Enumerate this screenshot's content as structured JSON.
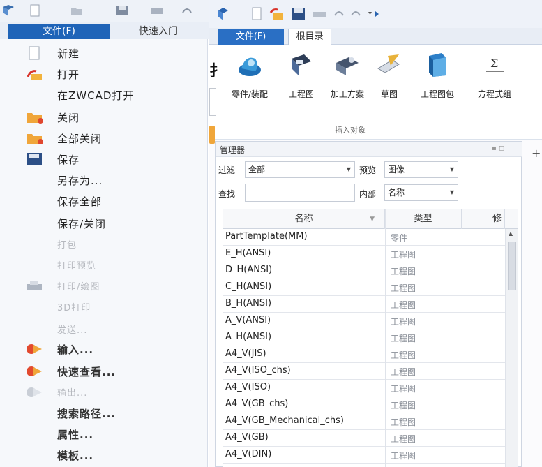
{
  "left_app": {
    "tabs": {
      "file": "文件(F)",
      "quick_start": "快速入门"
    },
    "menu": [
      {
        "label": "新建",
        "icon": "new-file-icon",
        "state": "normal"
      },
      {
        "label": "打开",
        "icon": "open-folder-icon",
        "state": "normal"
      },
      {
        "label": "在ZWCAD打开",
        "icon": "",
        "state": "normal"
      },
      {
        "label": "关闭",
        "icon": "close-folder-icon",
        "state": "normal"
      },
      {
        "label": "全部关闭",
        "icon": "close-all-icon",
        "state": "normal"
      },
      {
        "label": "保存",
        "icon": "save-icon",
        "state": "normal"
      },
      {
        "label": "另存为...",
        "icon": "",
        "state": "normal"
      },
      {
        "label": "保存全部",
        "icon": "",
        "state": "normal"
      },
      {
        "label": "保存/关闭",
        "icon": "",
        "state": "normal"
      },
      {
        "label": "打包",
        "icon": "",
        "state": "disabled"
      },
      {
        "label": "打印预览",
        "icon": "",
        "state": "disabled"
      },
      {
        "label": "打印/绘图",
        "icon": "printer-icon",
        "state": "disabled"
      },
      {
        "label": "3D打印",
        "icon": "",
        "state": "disabled"
      },
      {
        "label": "发送...",
        "icon": "",
        "state": "disabled"
      },
      {
        "label": "输入...",
        "icon": "import-icon",
        "state": "bold"
      },
      {
        "label": "快速查看...",
        "icon": "quick-view-icon",
        "state": "bold"
      },
      {
        "label": "输出...",
        "icon": "export-icon",
        "state": "disabled"
      },
      {
        "label": "搜索路径...",
        "icon": "",
        "state": "bold"
      },
      {
        "label": "属性...",
        "icon": "",
        "state": "bold"
      },
      {
        "label": "模板...",
        "icon": "",
        "state": "bold"
      }
    ]
  },
  "right_app": {
    "tabs": {
      "file": "文件(F)",
      "root": "根目录"
    },
    "ribbon": {
      "edge_char": "扌",
      "buttons": [
        {
          "label": "零件/装配",
          "icon": "part-assembly-icon"
        },
        {
          "label": "工程图",
          "icon": "drawing-icon"
        },
        {
          "label": "加工方案",
          "icon": "machining-plan-icon"
        },
        {
          "label": "草图",
          "icon": "sketch-icon"
        },
        {
          "label": "工程图包",
          "icon": "drawing-pack-icon"
        },
        {
          "label": "方程式组",
          "icon": "equation-set-icon"
        }
      ],
      "group_label": "插入对象"
    },
    "manager": {
      "title": "管理器",
      "filter_label": "过滤",
      "filter_value": "全部",
      "preview_label": "预览",
      "preview_value": "图像",
      "search_label": "查找",
      "search_value": "",
      "scope_label": "内部",
      "scope_value": "名称",
      "columns": [
        "名称",
        "类型",
        "修"
      ],
      "rows": [
        {
          "name": "PartTemplate(MM)",
          "type": "零件"
        },
        {
          "name": "E_H(ANSI)",
          "type": "工程图"
        },
        {
          "name": "D_H(ANSI)",
          "type": "工程图"
        },
        {
          "name": "C_H(ANSI)",
          "type": "工程图"
        },
        {
          "name": "B_H(ANSI)",
          "type": "工程图"
        },
        {
          "name": "A_V(ANSI)",
          "type": "工程图"
        },
        {
          "name": "A_H(ANSI)",
          "type": "工程图"
        },
        {
          "name": "A4_V(JIS)",
          "type": "工程图"
        },
        {
          "name": "A4_V(ISO_chs)",
          "type": "工程图"
        },
        {
          "name": "A4_V(ISO)",
          "type": "工程图"
        },
        {
          "name": "A4_V(GB_chs)",
          "type": "工程图"
        },
        {
          "name": "A4_V(GB_Mechanical_chs)",
          "type": "工程图"
        },
        {
          "name": "A4_V(GB)",
          "type": "工程图"
        },
        {
          "name": "A4_V(DIN)",
          "type": "工程图"
        }
      ]
    },
    "right_strip_char": "+"
  },
  "colors": {
    "file_tab_left": "#1f64b8",
    "file_tab_right": "#2a6fc4",
    "disabled_text": "#b6b9bf"
  }
}
